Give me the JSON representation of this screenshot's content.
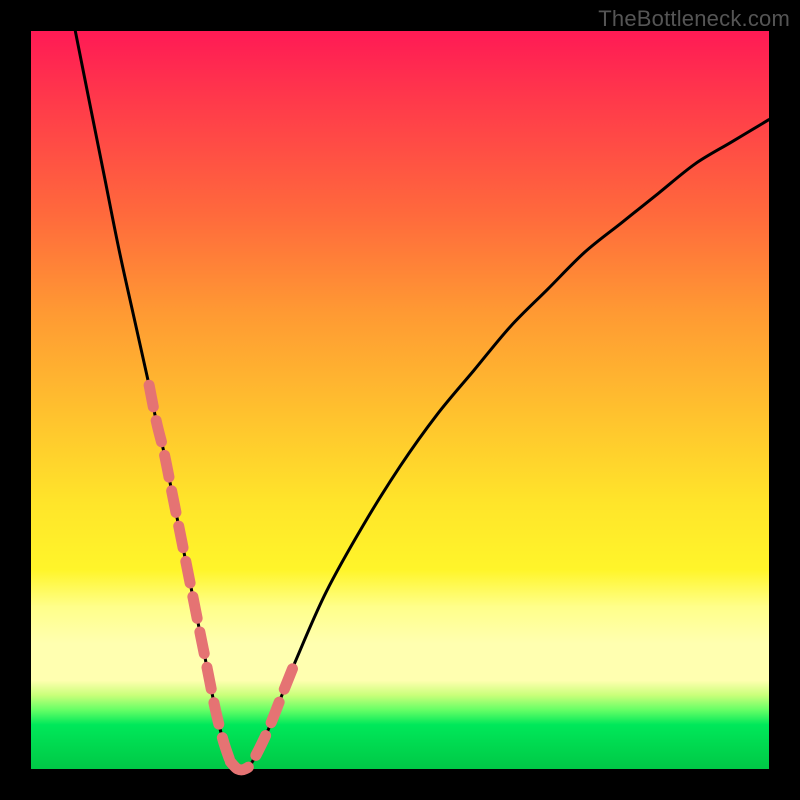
{
  "watermark": "TheBottleneck.com",
  "colors": {
    "frame": "#000000",
    "curve": "#000000",
    "dash": "#e57373",
    "gradient_stops": [
      "#ff1a55",
      "#ff3b4a",
      "#ff6a3c",
      "#ff9933",
      "#ffc22e",
      "#ffe52a",
      "#fff52a",
      "#ffff8a",
      "#ffffb0",
      "#c9ff7a",
      "#66ff66",
      "#00e85a",
      "#00d84f",
      "#00c846"
    ]
  },
  "chart_data": {
    "type": "line",
    "title": "",
    "xlabel": "",
    "ylabel": "",
    "xlim": [
      0,
      100
    ],
    "ylim": [
      0,
      100
    ],
    "series": [
      {
        "name": "bottleneck-curve",
        "x": [
          6,
          8,
          10,
          12,
          14,
          16,
          17,
          18,
          19,
          20,
          21,
          22,
          23,
          24,
          25,
          26,
          27,
          28,
          29,
          30,
          32,
          34,
          36,
          40,
          45,
          50,
          55,
          60,
          65,
          70,
          75,
          80,
          85,
          90,
          95,
          100
        ],
        "y": [
          100,
          90,
          80,
          70,
          61,
          52,
          47,
          43,
          38,
          33,
          28,
          23,
          18,
          13,
          8,
          4,
          1,
          0,
          0,
          1,
          5,
          10,
          15,
          24,
          33,
          41,
          48,
          54,
          60,
          65,
          70,
          74,
          78,
          82,
          85,
          88
        ]
      }
    ],
    "highlighted_x_ranges": [
      {
        "branch": "left",
        "x_from": 16,
        "x_to": 27
      },
      {
        "branch": "right",
        "x_from": 27,
        "x_to": 36
      }
    ],
    "annotations": []
  }
}
